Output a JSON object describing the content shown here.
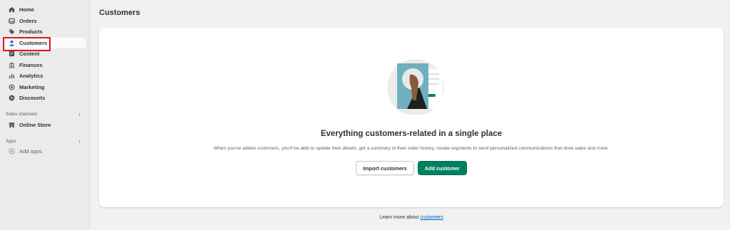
{
  "sidebar": {
    "items": [
      {
        "label": "Home",
        "icon": "home-icon"
      },
      {
        "label": "Orders",
        "icon": "inbox-icon"
      },
      {
        "label": "Products",
        "icon": "tag-icon"
      },
      {
        "label": "Customers",
        "icon": "person-icon",
        "active": true
      },
      {
        "label": "Content",
        "icon": "content-icon"
      },
      {
        "label": "Finances",
        "icon": "bank-icon"
      },
      {
        "label": "Analytics",
        "icon": "bar-chart-icon"
      },
      {
        "label": "Marketing",
        "icon": "target-icon"
      },
      {
        "label": "Discounts",
        "icon": "discount-icon"
      }
    ],
    "sales_channels": {
      "label": "Sales channels",
      "items": [
        {
          "label": "Online Store",
          "icon": "store-icon"
        }
      ]
    },
    "apps": {
      "label": "Apps",
      "add_label": "Add apps"
    }
  },
  "main": {
    "title": "Customers",
    "empty_state": {
      "heading": "Everything customers-related in a single place",
      "description": "When you've added customers, you'll be able to update their details, get a summary of their order history, create segments to send personalized communications that drive sales and more.",
      "import_label": "Import customers",
      "add_label": "Add customer"
    },
    "footer": {
      "prefix": "Learn more about ",
      "link": "customers"
    }
  },
  "colors": {
    "primary": "#008060",
    "highlight": "#e0161b",
    "link": "#005bd3"
  }
}
